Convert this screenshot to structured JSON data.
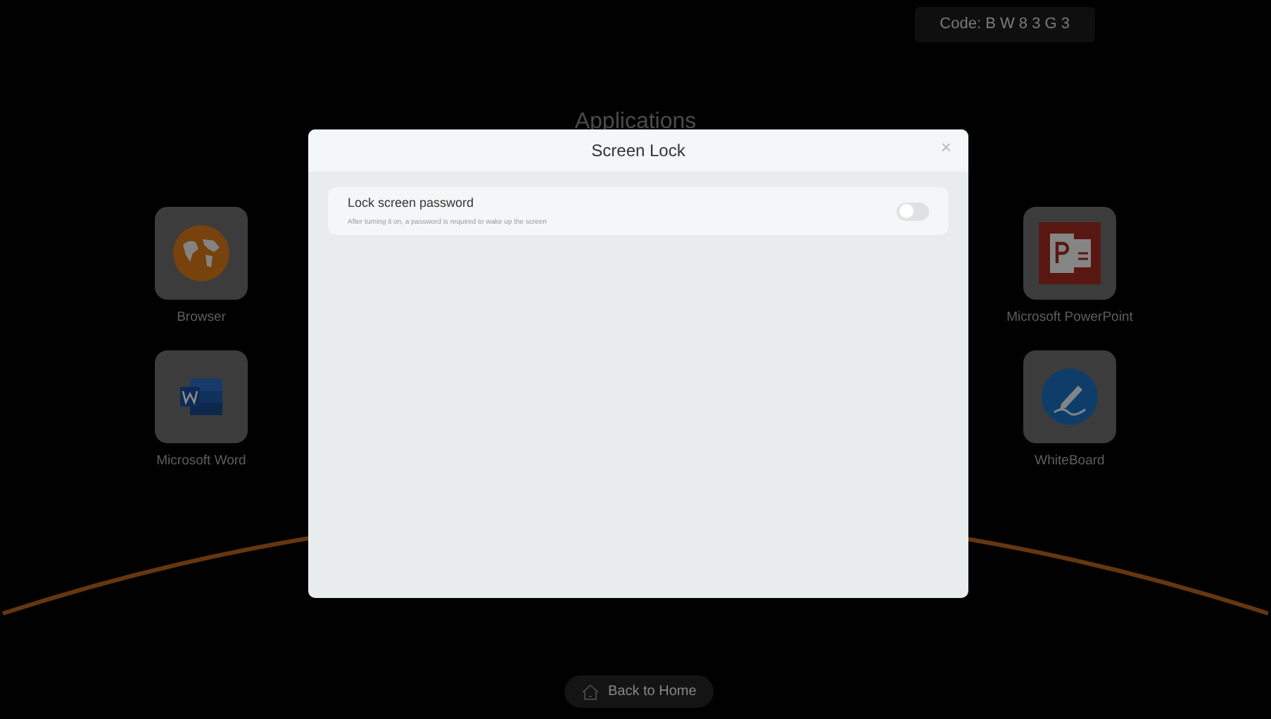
{
  "code_badge": {
    "label": "Code:",
    "value": "B W 8 3 G 3"
  },
  "page_title": "Applications",
  "apps_left": [
    {
      "name": "Browser",
      "kind": "globe"
    },
    {
      "name": "Microsoft Word",
      "kind": "word"
    }
  ],
  "apps_right": [
    {
      "name": "Microsoft PowerPoint",
      "kind": "powerpoint"
    },
    {
      "name": "WhiteBoard",
      "kind": "whiteboard"
    }
  ],
  "dialog": {
    "title": "Screen Lock",
    "close": "×",
    "settings": [
      {
        "label": "Lock screen password",
        "description": "After turning it on, a password is required to wake up the screen",
        "on": false
      }
    ]
  },
  "home_button": {
    "label": "Back to Home"
  }
}
